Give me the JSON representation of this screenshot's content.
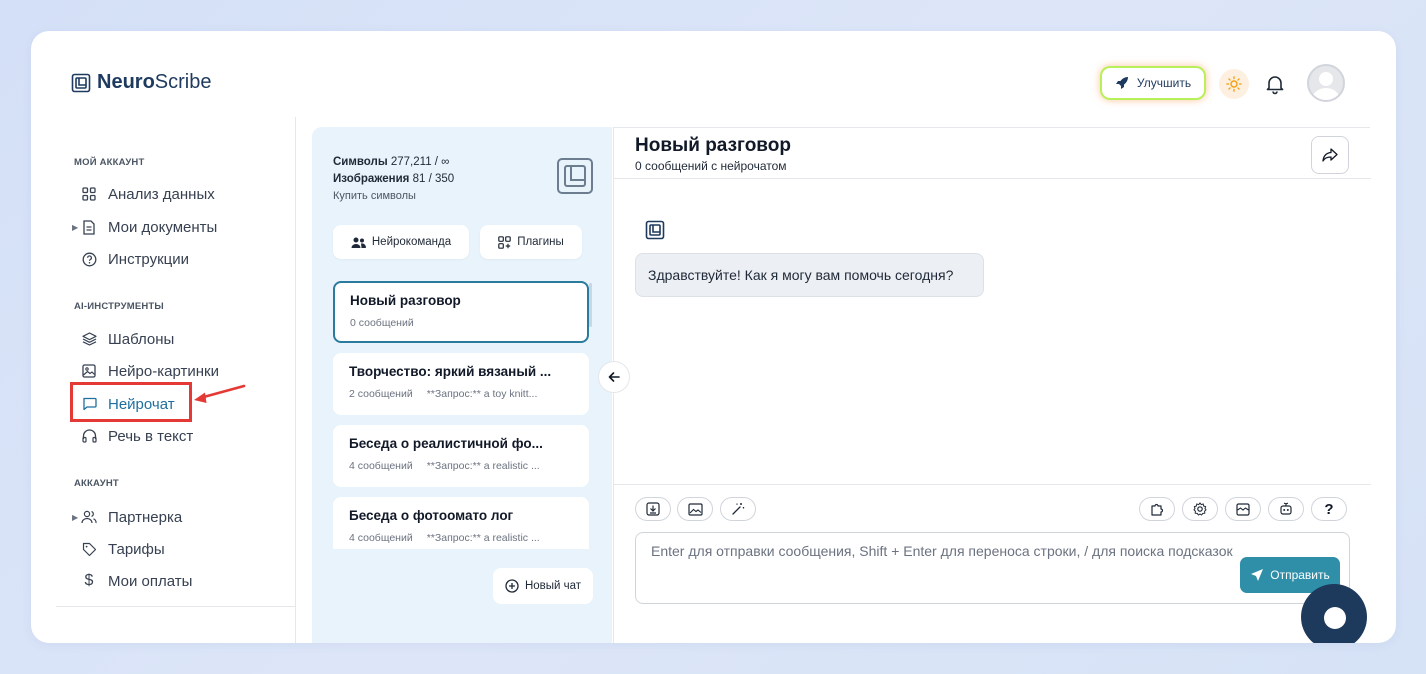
{
  "app": {
    "logo_bold": "Neuro",
    "logo_rest": "Scribe",
    "upgrade_label": "Улучшить"
  },
  "sidebar": {
    "section_account": "МОЙ АККАУНТ",
    "section_ai": "AI-ИНСТРУМЕНТЫ",
    "section_user": "АККАУНТ",
    "items": [
      {
        "label": "Анализ данных",
        "icon": "grid-icon"
      },
      {
        "label": "Мои документы",
        "icon": "document-icon",
        "expandable": true
      },
      {
        "label": "Инструкции",
        "icon": "help-circle-icon"
      },
      {
        "label": "Шаблоны",
        "icon": "layers-icon"
      },
      {
        "label": "Нейро-картинки",
        "icon": "image-icon"
      },
      {
        "label": "Нейрочат",
        "icon": "chat-icon",
        "active": true
      },
      {
        "label": "Речь в текст",
        "icon": "headphones-icon"
      },
      {
        "label": "Партнерка",
        "icon": "users-icon",
        "expandable": true
      },
      {
        "label": "Тарифы",
        "icon": "tag-icon"
      },
      {
        "label": "Мои оплаты",
        "icon": "dollar-icon"
      }
    ]
  },
  "usage": {
    "symbols_label": "Символы",
    "symbols_value": "277,211 / ∞",
    "images_label": "Изображения",
    "images_value": "81 / 350",
    "buy_label": "Купить символы"
  },
  "list": {
    "team_label": "Нейрокоманда",
    "plugins_label": "Плагины",
    "new_chat_label": "Новый чат",
    "conversations": [
      {
        "title": "Новый разговор",
        "count": "0 сообщений",
        "preview": ""
      },
      {
        "title": "Творчество: яркий вязаный ...",
        "count": "2 сообщений",
        "preview": "**Запрос:** a toy knitt..."
      },
      {
        "title": "Беседа о реалистичной фо...",
        "count": "4 сообщений",
        "preview": "**Запрос:** a realistic ..."
      },
      {
        "title": "Беседа о фотоомато лог",
        "count": "4 сообщений",
        "preview": "**Запрос:** a realistic ..."
      }
    ]
  },
  "chat": {
    "title": "Новый разговор",
    "subtitle": "0 сообщений с нейрочатом",
    "greeting": "Здравствуйте! Как я могу вам помочь сегодня?",
    "input_placeholder": "Enter для отправки сообщения, Shift + Enter для переноса строки, / для поиска подсказок",
    "send_label": "Отправить",
    "help_label": "?"
  },
  "colors": {
    "accent": "#2f8fa8",
    "active_nav": "#1e6f9f",
    "highlight": "#e53935",
    "list_panel_bg": "#e8f3fb",
    "fab": "#1d3a5c"
  }
}
